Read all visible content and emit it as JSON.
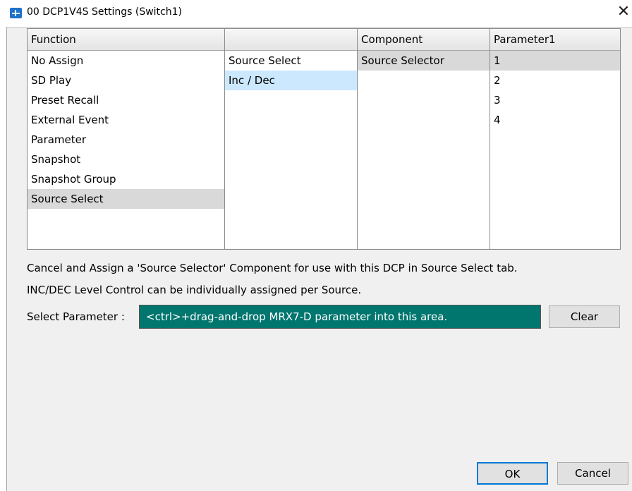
{
  "window": {
    "title": "00 DCP1V4S Settings (Switch1)",
    "close_glyph": "✕",
    "icon": "app-icon"
  },
  "columns": {
    "function": {
      "header": "Function",
      "items": [
        "No Assign",
        "SD Play",
        "Preset Recall",
        "External Event",
        "Parameter",
        "Snapshot",
        "Snapshot Group",
        "Source Select"
      ],
      "selected": "Source Select"
    },
    "sub": {
      "header": "",
      "items": [
        "Source Select",
        "Inc / Dec"
      ],
      "selected": "Inc / Dec"
    },
    "component": {
      "header": "Component",
      "items": [
        "Source Selector"
      ],
      "selected": "Source Selector"
    },
    "parameter1": {
      "header": "Parameter1",
      "items": [
        "1",
        "2",
        "3",
        "4"
      ],
      "selected": "1"
    }
  },
  "info": {
    "line1": "Cancel and Assign a 'Source Selector' Component for use with this DCP in Source Select tab.",
    "line2": "INC/DEC Level Control can be individually assigned per Source."
  },
  "select_parameter": {
    "label": "Select Parameter :",
    "drop_text": "<ctrl>+drag-and-drop MRX7-D parameter into this area.",
    "clear_label": "Clear"
  },
  "buttons": {
    "ok": "OK",
    "cancel": "Cancel"
  },
  "colors": {
    "drop_area_bg": "#00766e",
    "selection_blue": "#cce8ff",
    "selection_gray": "#d9d9d9",
    "accent": "#0078d7"
  }
}
